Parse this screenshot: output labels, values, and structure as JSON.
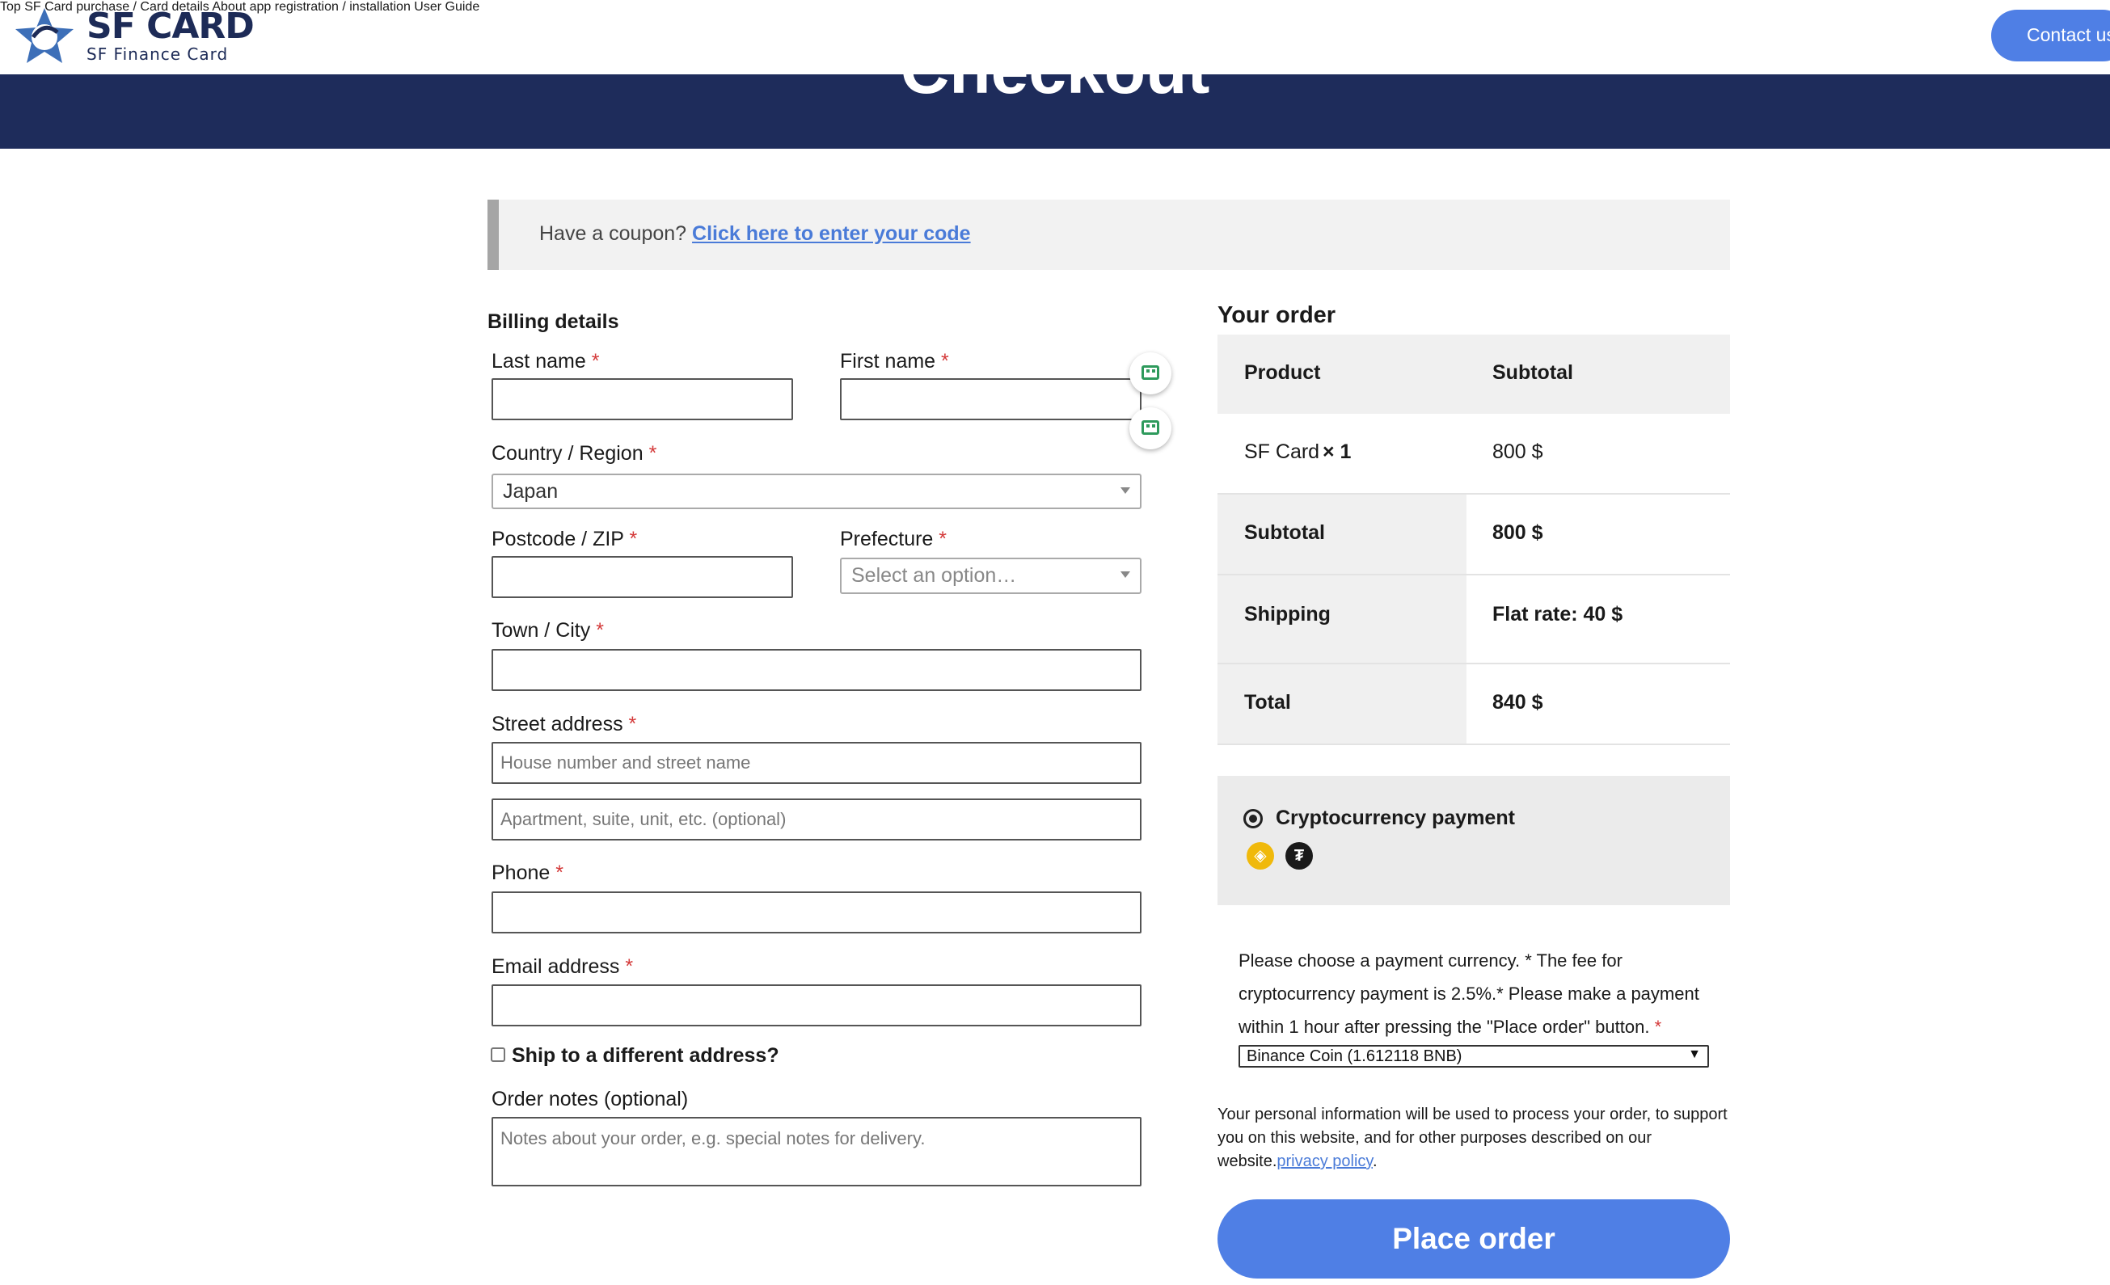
{
  "header": {
    "logo_main": "SF CARD",
    "logo_sub": "SF Finance Card",
    "nav": [
      {
        "label": "Top"
      },
      {
        "label": "SF Card purchase / Card details"
      },
      {
        "label": "About app registration / installation"
      },
      {
        "label": "User Guide"
      }
    ],
    "contact_label": "Contact us",
    "page_title": "Checkout"
  },
  "coupon": {
    "prompt": "Have a coupon?",
    "link": "Click here to enter your code"
  },
  "billing": {
    "heading": "Billing details",
    "required_mark": "*",
    "last_name": {
      "label": "Last name",
      "value": ""
    },
    "first_name": {
      "label": "First name",
      "value": ""
    },
    "country": {
      "label": "Country / Region",
      "value": "Japan"
    },
    "postcode": {
      "label": "Postcode / ZIP",
      "value": ""
    },
    "prefecture": {
      "label": "Prefecture",
      "placeholder": "Select an option…"
    },
    "town": {
      "label": "Town / City",
      "value": ""
    },
    "street": {
      "label": "Street address",
      "placeholder1": "House number and street name",
      "placeholder2": "Apartment, suite, unit, etc. (optional)"
    },
    "phone": {
      "label": "Phone",
      "value": ""
    },
    "email": {
      "label": "Email address",
      "value": ""
    },
    "ship_different": {
      "label": "Ship to a different address?",
      "checked": false
    },
    "notes": {
      "label": "Order notes (optional)",
      "placeholder": "Notes about your order, e.g. special notes for delivery."
    }
  },
  "order": {
    "heading": "Your order",
    "col_product": "Product",
    "col_subtotal": "Subtotal",
    "item_name": "SF Card",
    "item_qty": "× 1",
    "item_price": "800 $",
    "subtotal_label": "Subtotal",
    "subtotal_value": "800 $",
    "shipping_label": "Shipping",
    "shipping_value": "Flat rate: 40 $",
    "total_label": "Total",
    "total_value": "840 $"
  },
  "payment": {
    "method_label": "Cryptocurrency payment",
    "coin_icons": [
      "bnb-icon",
      "tether-icon"
    ],
    "description": "Please choose a payment currency. * The fee for cryptocurrency payment is 2.5%.* Please make a payment within 1 hour after pressing the \"Place order\" button.",
    "currency_selected": "Binance Coin (1.612118 BNB)",
    "privacy_text": "Your personal information will be used to process your order, to support you on this website, and for other purposes described on our website.",
    "privacy_link": "privacy policy",
    "place_order": "Place order"
  },
  "colors": {
    "brand_navy": "#1e2c5b",
    "accent_blue": "#4f7fe5",
    "link_blue": "#4a7bd8",
    "required_red": "#d43a3a"
  }
}
